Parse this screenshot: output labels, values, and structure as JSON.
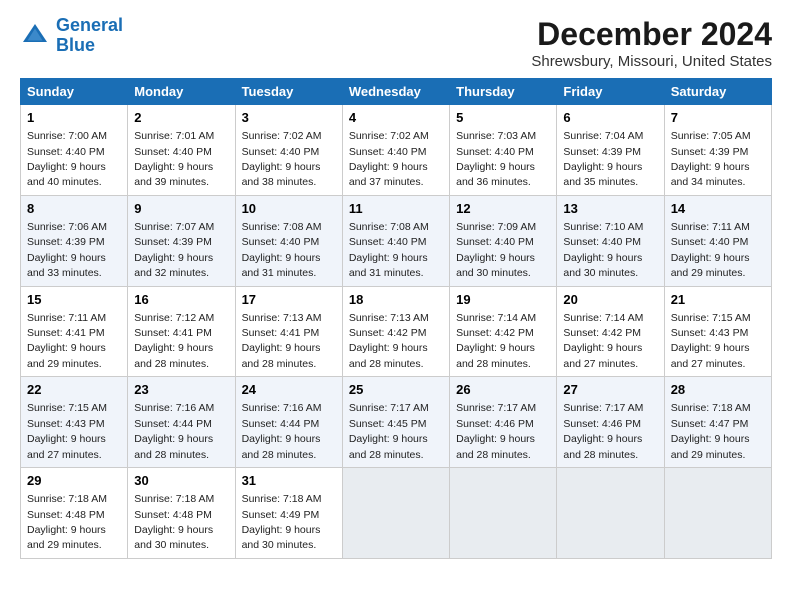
{
  "logo": {
    "line1": "General",
    "line2": "Blue"
  },
  "title": "December 2024",
  "subtitle": "Shrewsbury, Missouri, United States",
  "days_of_week": [
    "Sunday",
    "Monday",
    "Tuesday",
    "Wednesday",
    "Thursday",
    "Friday",
    "Saturday"
  ],
  "weeks": [
    [
      {
        "day": 1,
        "sunrise": "7:00 AM",
        "sunset": "4:40 PM",
        "daylight": "9 hours and 40 minutes."
      },
      {
        "day": 2,
        "sunrise": "7:01 AM",
        "sunset": "4:40 PM",
        "daylight": "9 hours and 39 minutes."
      },
      {
        "day": 3,
        "sunrise": "7:02 AM",
        "sunset": "4:40 PM",
        "daylight": "9 hours and 38 minutes."
      },
      {
        "day": 4,
        "sunrise": "7:02 AM",
        "sunset": "4:40 PM",
        "daylight": "9 hours and 37 minutes."
      },
      {
        "day": 5,
        "sunrise": "7:03 AM",
        "sunset": "4:40 PM",
        "daylight": "9 hours and 36 minutes."
      },
      {
        "day": 6,
        "sunrise": "7:04 AM",
        "sunset": "4:39 PM",
        "daylight": "9 hours and 35 minutes."
      },
      {
        "day": 7,
        "sunrise": "7:05 AM",
        "sunset": "4:39 PM",
        "daylight": "9 hours and 34 minutes."
      }
    ],
    [
      {
        "day": 8,
        "sunrise": "7:06 AM",
        "sunset": "4:39 PM",
        "daylight": "9 hours and 33 minutes."
      },
      {
        "day": 9,
        "sunrise": "7:07 AM",
        "sunset": "4:39 PM",
        "daylight": "9 hours and 32 minutes."
      },
      {
        "day": 10,
        "sunrise": "7:08 AM",
        "sunset": "4:40 PM",
        "daylight": "9 hours and 31 minutes."
      },
      {
        "day": 11,
        "sunrise": "7:08 AM",
        "sunset": "4:40 PM",
        "daylight": "9 hours and 31 minutes."
      },
      {
        "day": 12,
        "sunrise": "7:09 AM",
        "sunset": "4:40 PM",
        "daylight": "9 hours and 30 minutes."
      },
      {
        "day": 13,
        "sunrise": "7:10 AM",
        "sunset": "4:40 PM",
        "daylight": "9 hours and 30 minutes."
      },
      {
        "day": 14,
        "sunrise": "7:11 AM",
        "sunset": "4:40 PM",
        "daylight": "9 hours and 29 minutes."
      }
    ],
    [
      {
        "day": 15,
        "sunrise": "7:11 AM",
        "sunset": "4:41 PM",
        "daylight": "9 hours and 29 minutes."
      },
      {
        "day": 16,
        "sunrise": "7:12 AM",
        "sunset": "4:41 PM",
        "daylight": "9 hours and 28 minutes."
      },
      {
        "day": 17,
        "sunrise": "7:13 AM",
        "sunset": "4:41 PM",
        "daylight": "9 hours and 28 minutes."
      },
      {
        "day": 18,
        "sunrise": "7:13 AM",
        "sunset": "4:42 PM",
        "daylight": "9 hours and 28 minutes."
      },
      {
        "day": 19,
        "sunrise": "7:14 AM",
        "sunset": "4:42 PM",
        "daylight": "9 hours and 28 minutes."
      },
      {
        "day": 20,
        "sunrise": "7:14 AM",
        "sunset": "4:42 PM",
        "daylight": "9 hours and 27 minutes."
      },
      {
        "day": 21,
        "sunrise": "7:15 AM",
        "sunset": "4:43 PM",
        "daylight": "9 hours and 27 minutes."
      }
    ],
    [
      {
        "day": 22,
        "sunrise": "7:15 AM",
        "sunset": "4:43 PM",
        "daylight": "9 hours and 27 minutes."
      },
      {
        "day": 23,
        "sunrise": "7:16 AM",
        "sunset": "4:44 PM",
        "daylight": "9 hours and 28 minutes."
      },
      {
        "day": 24,
        "sunrise": "7:16 AM",
        "sunset": "4:44 PM",
        "daylight": "9 hours and 28 minutes."
      },
      {
        "day": 25,
        "sunrise": "7:17 AM",
        "sunset": "4:45 PM",
        "daylight": "9 hours and 28 minutes."
      },
      {
        "day": 26,
        "sunrise": "7:17 AM",
        "sunset": "4:46 PM",
        "daylight": "9 hours and 28 minutes."
      },
      {
        "day": 27,
        "sunrise": "7:17 AM",
        "sunset": "4:46 PM",
        "daylight": "9 hours and 28 minutes."
      },
      {
        "day": 28,
        "sunrise": "7:18 AM",
        "sunset": "4:47 PM",
        "daylight": "9 hours and 29 minutes."
      }
    ],
    [
      {
        "day": 29,
        "sunrise": "7:18 AM",
        "sunset": "4:48 PM",
        "daylight": "9 hours and 29 minutes."
      },
      {
        "day": 30,
        "sunrise": "7:18 AM",
        "sunset": "4:48 PM",
        "daylight": "9 hours and 30 minutes."
      },
      {
        "day": 31,
        "sunrise": "7:18 AM",
        "sunset": "4:49 PM",
        "daylight": "9 hours and 30 minutes."
      },
      null,
      null,
      null,
      null
    ]
  ]
}
